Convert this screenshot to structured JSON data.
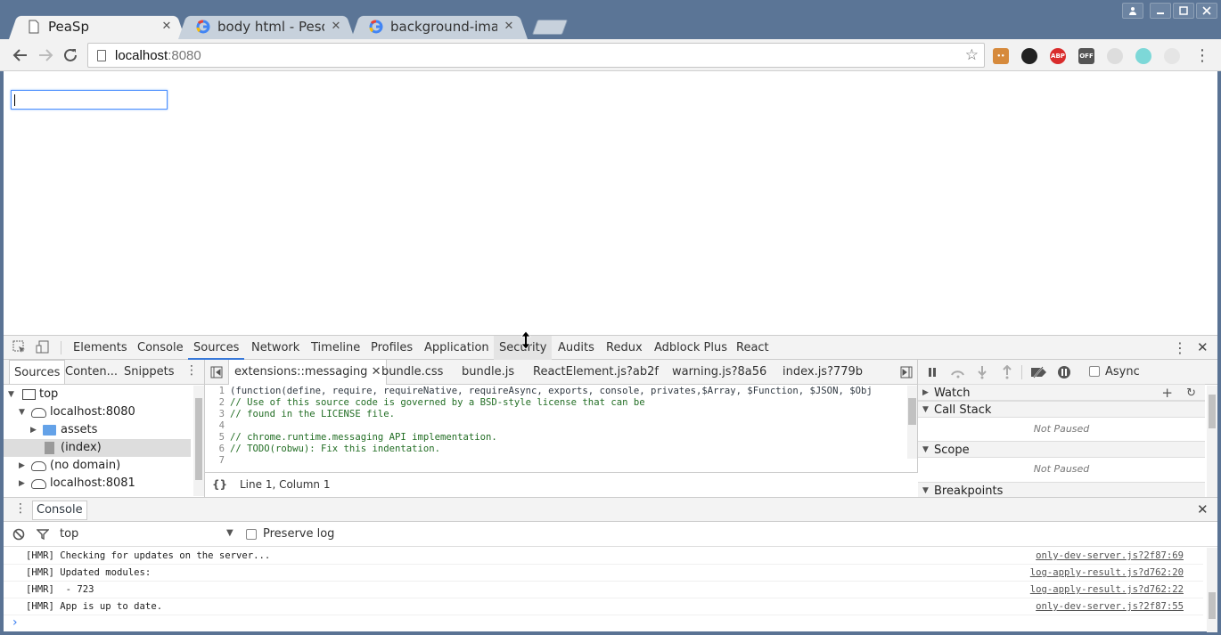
{
  "browser": {
    "tabs": [
      {
        "title": "PeaSp",
        "close": "✕"
      },
      {
        "title": "body html - Pesqui",
        "close": "✕"
      },
      {
        "title": "background-image",
        "close": "✕"
      }
    ],
    "url_host": "localhost",
    "url_port": ":8080",
    "extensions": [
      "ABP",
      "OFF"
    ]
  },
  "devtools": {
    "tabs": [
      "Elements",
      "Console",
      "Sources",
      "Network",
      "Timeline",
      "Profiles",
      "Application",
      "Security",
      "Audits",
      "Redux",
      "Adblock Plus",
      "React"
    ],
    "active_tab": "Sources",
    "navigator": {
      "tabs": [
        "Sources",
        "Conten...",
        "Snippets"
      ],
      "tree": [
        "top",
        "localhost:8080",
        "assets",
        "(index)",
        "(no domain)",
        "localhost:8081"
      ]
    },
    "editor": {
      "tabs": [
        "extensions::messaging",
        "bundle.css",
        "bundle.js",
        "ReactElement.js?ab2f",
        "warning.js?8a56",
        "index.js?779b"
      ],
      "lines": [
        {
          "n": "1",
          "text": "(function(define, require, requireNative, requireAsync, exports, console, privates,$Array, $Function, $JSON, $Obj"
        },
        {
          "n": "2",
          "text": "// Use of this source code is governed by a BSD-style license that can be"
        },
        {
          "n": "3",
          "text": "// found in the LICENSE file."
        },
        {
          "n": "4",
          "text": ""
        },
        {
          "n": "5",
          "text": "// chrome.runtime.messaging API implementation."
        },
        {
          "n": "6",
          "text": "// TODO(robwu): Fix this indentation."
        },
        {
          "n": "7",
          "text": ""
        }
      ],
      "status_icon": "{}",
      "status": "Line 1, Column 1"
    },
    "debugger": {
      "async_label": "Async",
      "sections": [
        "Watch",
        "Call Stack",
        "Scope",
        "Breakpoints"
      ],
      "not_paused": "Not Paused"
    },
    "drawer": {
      "tab": "Console",
      "context": "top",
      "preserve_log": "Preserve log",
      "messages": [
        {
          "msg": "[HMR] Checking for updates on the server...",
          "src": "only-dev-server.js?2f87:69"
        },
        {
          "msg": "[HMR] Updated modules:",
          "src": "log-apply-result.js?d762:20"
        },
        {
          "msg": "[HMR]  - 723",
          "src": "log-apply-result.js?d762:22"
        },
        {
          "msg": "[HMR] App is up to date.",
          "src": "only-dev-server.js?2f87:55"
        }
      ],
      "prompt": "›"
    }
  }
}
